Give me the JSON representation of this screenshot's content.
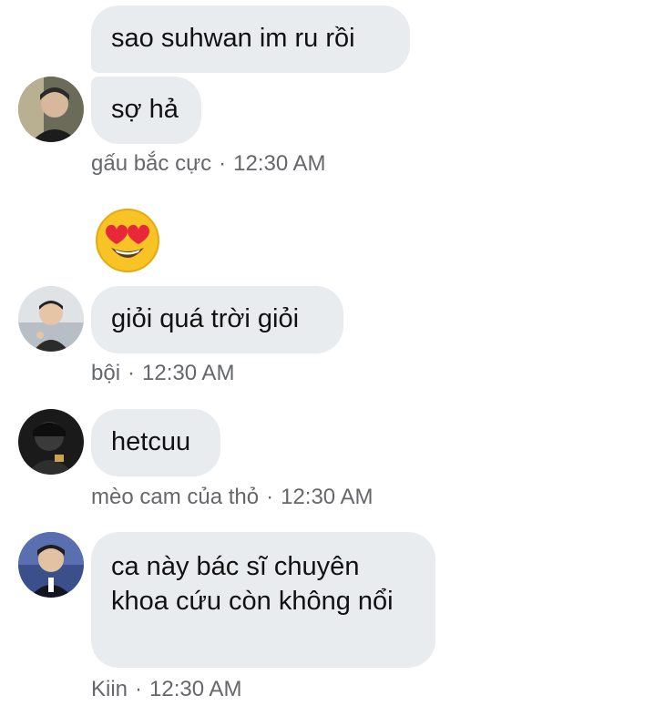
{
  "messages": [
    {
      "sender": "gấu bắc cực",
      "time": "12:30 AM",
      "avatar": "avatar-gau-bac-cuc",
      "lines": [
        "sao suhwan im ru rồi",
        "sợ hả"
      ]
    },
    {
      "sender": "bội",
      "time": "12:30 AM",
      "avatar": "avatar-boi",
      "reaction_emoji": "heart-eyes-emoji",
      "lines": [
        "giỏi quá trời giỏi"
      ]
    },
    {
      "sender": "mèo cam của thỏ",
      "time": "12:30 AM",
      "avatar": "avatar-meo-cam",
      "lines": [
        "hetcuu"
      ]
    },
    {
      "sender": "Kiin",
      "time": "12:30 AM",
      "avatar": "avatar-kiin",
      "lines": [
        "ca này bác sĩ chuyên khoa cứu còn không nổi"
      ]
    }
  ],
  "separator": "·",
  "colors": {
    "bubble_bg": "#e9ecef",
    "meta_text": "#65676b",
    "message_text": "#111111"
  }
}
